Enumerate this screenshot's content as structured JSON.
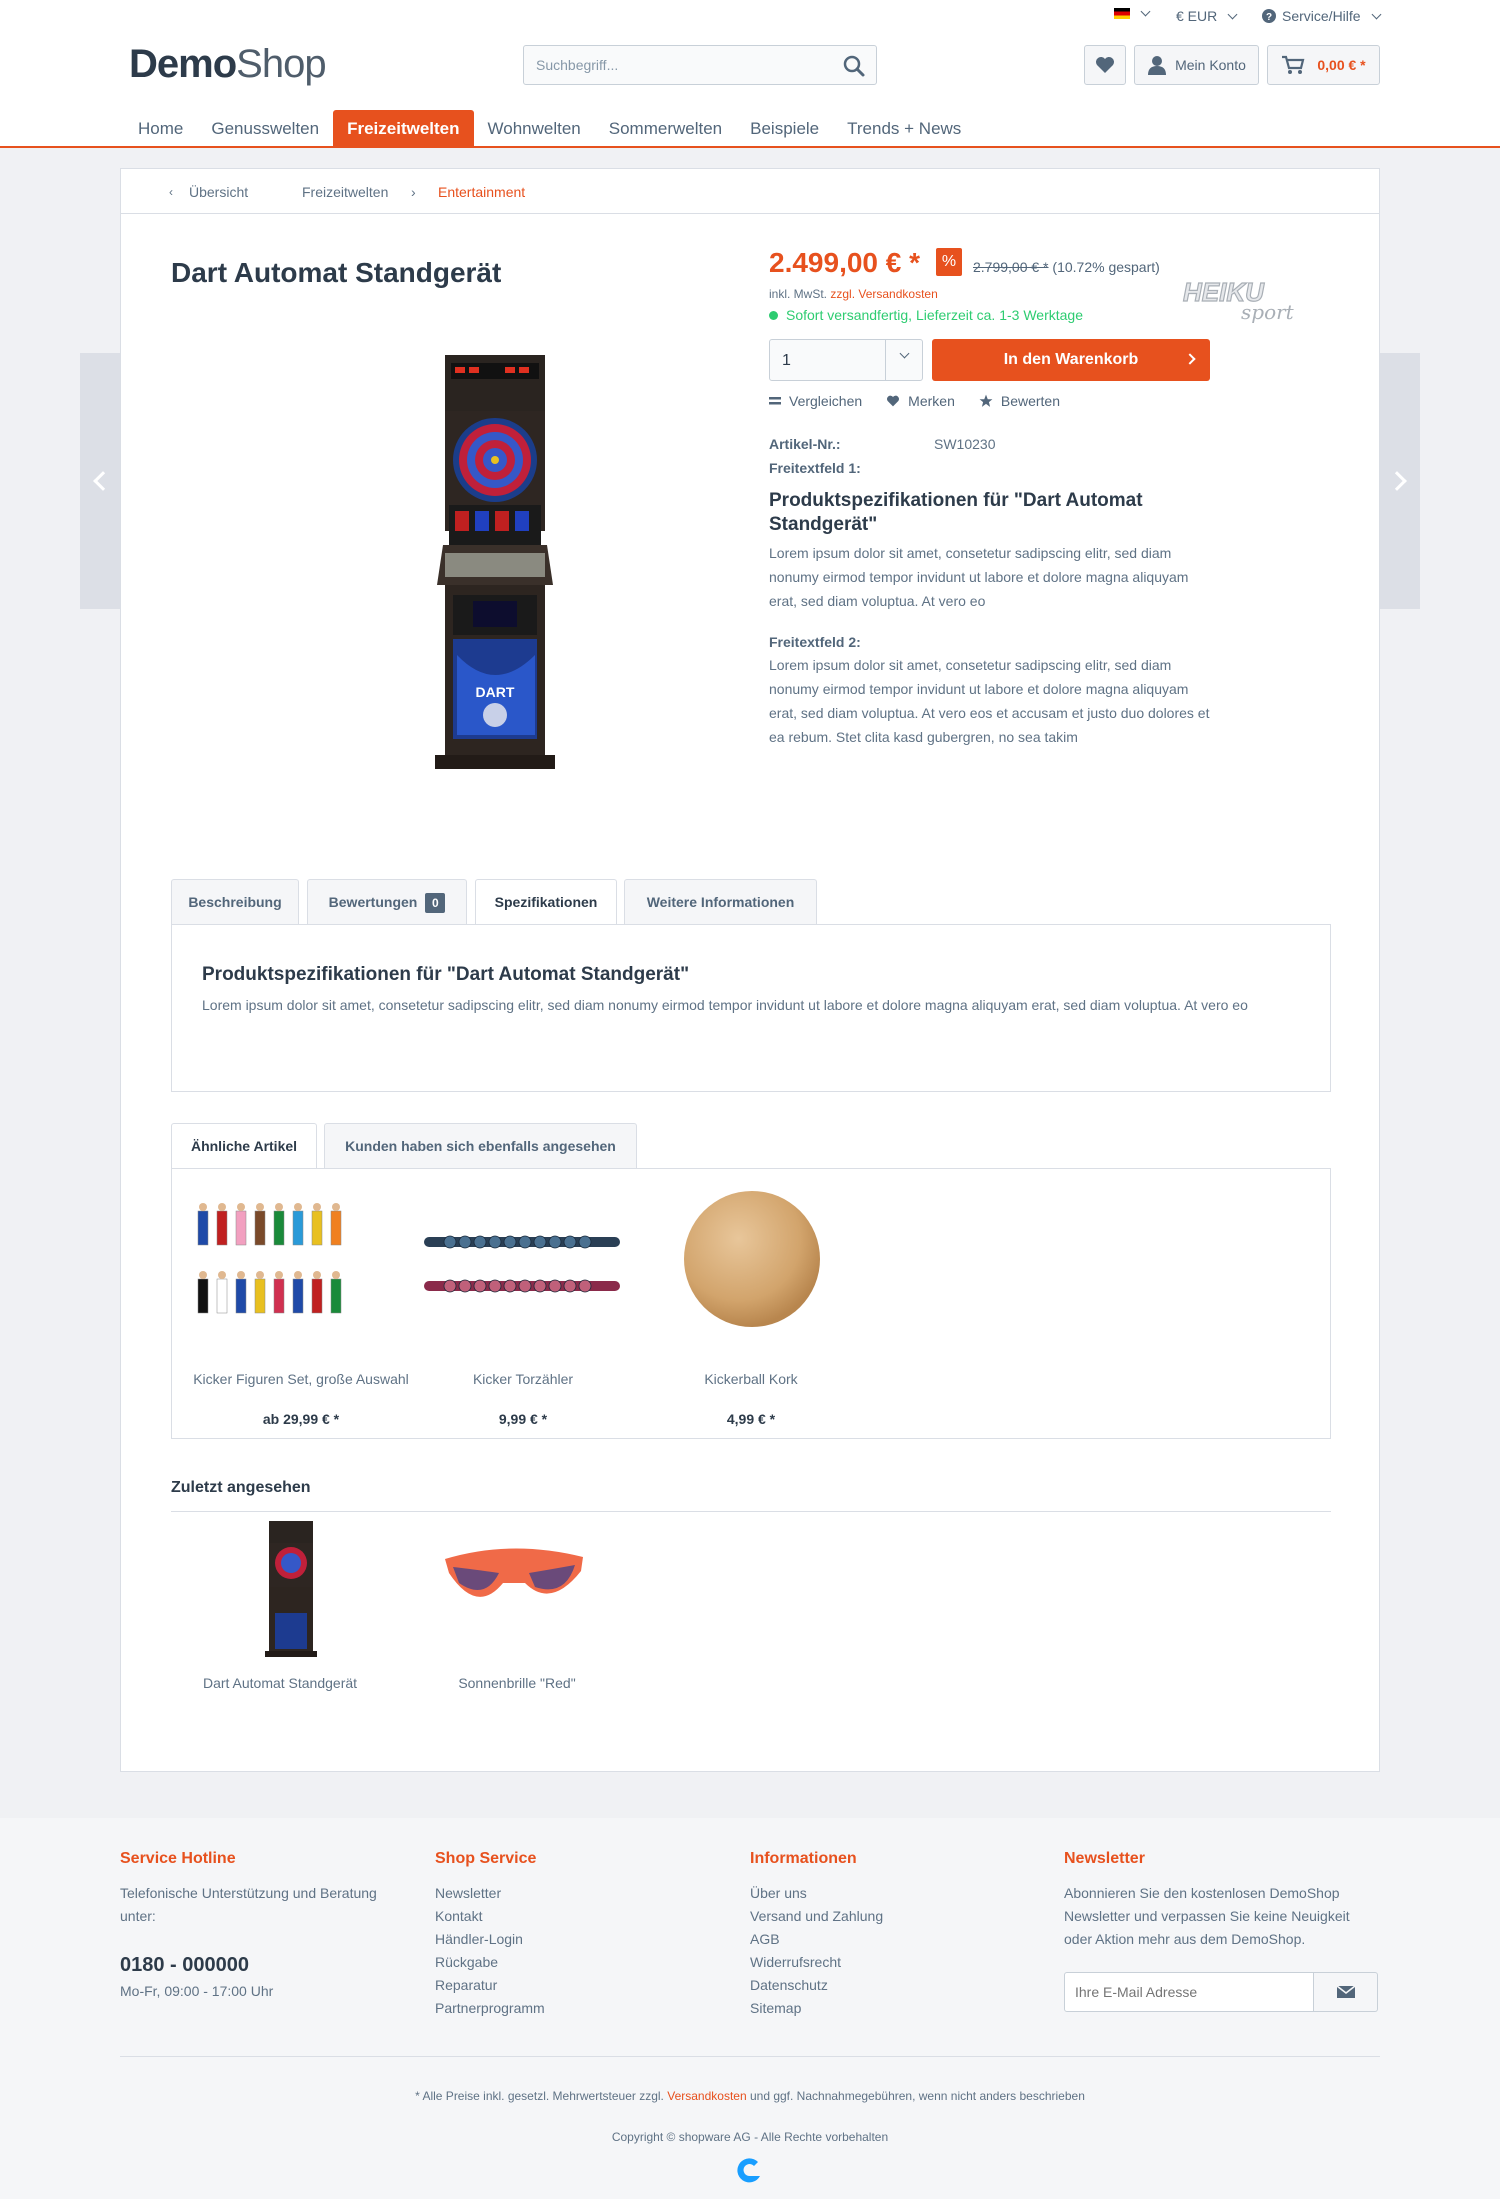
{
  "topbar": {
    "currency": "€ EUR",
    "service": "Service/Hilfe",
    "logo_bold": "Demo",
    "logo_light": "Shop",
    "search_placeholder": "Suchbegriff...",
    "account_label": "Mein Konto",
    "cart_total": "0,00 € *"
  },
  "nav": [
    "Home",
    "Genusswelten",
    "Freizeitwelten",
    "Wohnwelten",
    "Sommerwelten",
    "Beispiele",
    "Trends + News"
  ],
  "nav_active": "Freizeitwelten",
  "breadcrumb": {
    "back": "Übersicht",
    "level1": "Freizeitwelten",
    "level2": "Entertainment"
  },
  "product": {
    "title": "Dart Automat Standgerät",
    "brand": "HEIKU sport",
    "price": "2.499,00 € *",
    "discount_badge": "%",
    "old_price": "2.799,00 € *",
    "savings": "(10.72% gespart)",
    "tax_note_prefix": "inkl. MwSt.",
    "tax_note_link": "zzgl. Versandkosten",
    "delivery": "Sofort versandfertig, Lieferzeit ca. 1-3 Werktage",
    "quantity": "1",
    "add_to_cart": "In den Warenkorb",
    "actions": [
      "Vergleichen",
      "Merken",
      "Bewerten"
    ],
    "article_no_label": "Artikel-Nr.:",
    "article_no": "SW10230",
    "freetext1_label": "Freitextfeld 1:",
    "spec_heading": "Produktspezifikationen für \"Dart Automat Standgerät\"",
    "spec_text": "Lorem ipsum dolor sit amet, consetetur sadipscing elitr, sed diam nonumy eirmod tempor invidunt ut labore et dolore magna aliquyam erat, sed diam voluptua. At vero eo",
    "freetext2_label": "Freitextfeld 2:",
    "freetext2_text": "Lorem ipsum dolor sit amet, consetetur sadipscing elitr, sed diam nonumy eirmod tempor invidunt ut labore et dolore magna aliquyam erat, sed diam voluptua. At vero eos et accusam et justo duo dolores et ea rebum. Stet clita kasd gubergren, no sea takim"
  },
  "tabs": {
    "items": [
      "Beschreibung",
      "Bewertungen",
      "Spezifikationen",
      "Weitere Informationen"
    ],
    "reviews_count": "0",
    "active": "Spezifikationen",
    "panel_heading": "Produktspezifikationen für \"Dart Automat Standgerät\"",
    "panel_text": "Lorem ipsum dolor sit amet, consetetur sadipscing elitr, sed diam nonumy eirmod tempor invidunt ut labore et dolore magna aliquyam erat, sed diam voluptua. At vero eo"
  },
  "related": {
    "tabs": [
      "Ähnliche Artikel",
      "Kunden haben sich ebenfalls angesehen"
    ],
    "items": [
      {
        "name": "Kicker Figuren Set, große Auswahl",
        "price": "ab 29,99 € *"
      },
      {
        "name": "Kicker Torzähler",
        "price": "9,99 € *"
      },
      {
        "name": "Kickerball Kork",
        "price": "4,99 € *"
      }
    ]
  },
  "recent": {
    "heading": "Zuletzt angesehen",
    "items": [
      "Dart Automat Standgerät",
      "Sonnenbrille \"Red\""
    ]
  },
  "footer": {
    "hotline": {
      "heading": "Service Hotline",
      "text": "Telefonische Unterstützung und Beratung unter:",
      "phone": "0180 - 000000",
      "hours": "Mo-Fr, 09:00 - 17:00 Uhr"
    },
    "shop_service": {
      "heading": "Shop Service",
      "links": [
        "Newsletter",
        "Kontakt",
        "Händler-Login",
        "Rückgabe",
        "Reparatur",
        "Partnerprogramm"
      ]
    },
    "info": {
      "heading": "Informationen",
      "links": [
        "Über uns",
        "Versand und Zahlung",
        "AGB",
        "Widerrufsrecht",
        "Datenschutz",
        "Sitemap"
      ]
    },
    "newsletter": {
      "heading": "Newsletter",
      "text": "Abonnieren Sie den kostenlosen DemoShop Newsletter und verpassen Sie keine Neuigkeit oder Aktion mehr aus dem DemoShop.",
      "placeholder": "Ihre E-Mail Adresse"
    },
    "note_prefix": "* Alle Preise inkl. gesetzl. Mehrwertsteuer zzgl.",
    "note_link": "Versandkosten",
    "note_suffix": "und ggf. Nachnahmegebühren, wenn nicht anders beschrieben",
    "copyright": "Copyright © shopware AG - Alle Rechte vorbehalten"
  },
  "colors": {
    "accent": "#e7511e",
    "text": "#5f7285",
    "heading": "#2d3b4a",
    "success": "#2ecc71"
  }
}
